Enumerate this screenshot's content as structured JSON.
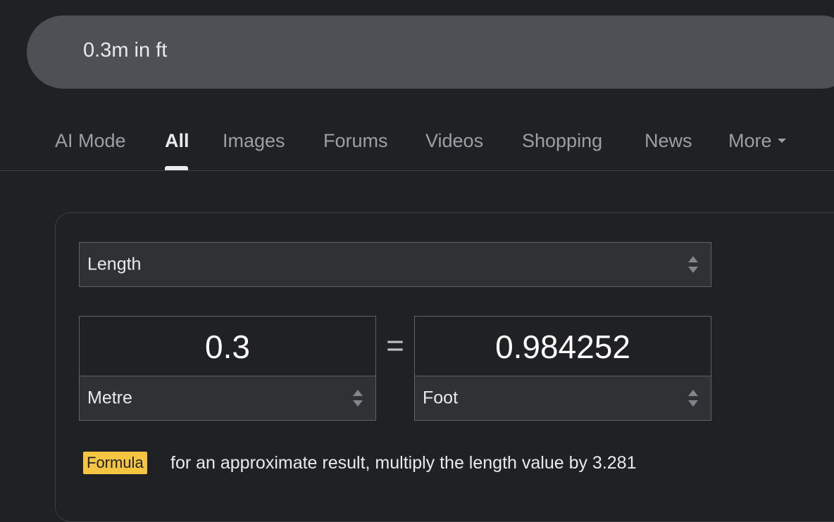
{
  "search": {
    "query": "0.3m in ft"
  },
  "tabs": [
    {
      "label": "AI Mode",
      "active": false
    },
    {
      "label": "All",
      "active": true
    },
    {
      "label": "Images",
      "active": false
    },
    {
      "label": "Forums",
      "active": false
    },
    {
      "label": "Videos",
      "active": false
    },
    {
      "label": "Shopping",
      "active": false
    },
    {
      "label": "News",
      "active": false
    },
    {
      "label": "More",
      "active": false
    }
  ],
  "converter": {
    "unit_type": "Length",
    "from_value": "0.3",
    "equals_sign": "=",
    "to_value": "0.984252",
    "from_unit": "Metre",
    "to_unit": "Foot",
    "formula_label": "Formula",
    "formula_text": "for an approximate result, multiply the length value by 3.281"
  },
  "colors": {
    "background": "#202124",
    "search_bar": "#4d5156",
    "formula_badge": "#f5c542"
  },
  "icons": {
    "more_dropdown": "chevron-down-icon",
    "select_arrows": "updown-arrows-icon"
  }
}
